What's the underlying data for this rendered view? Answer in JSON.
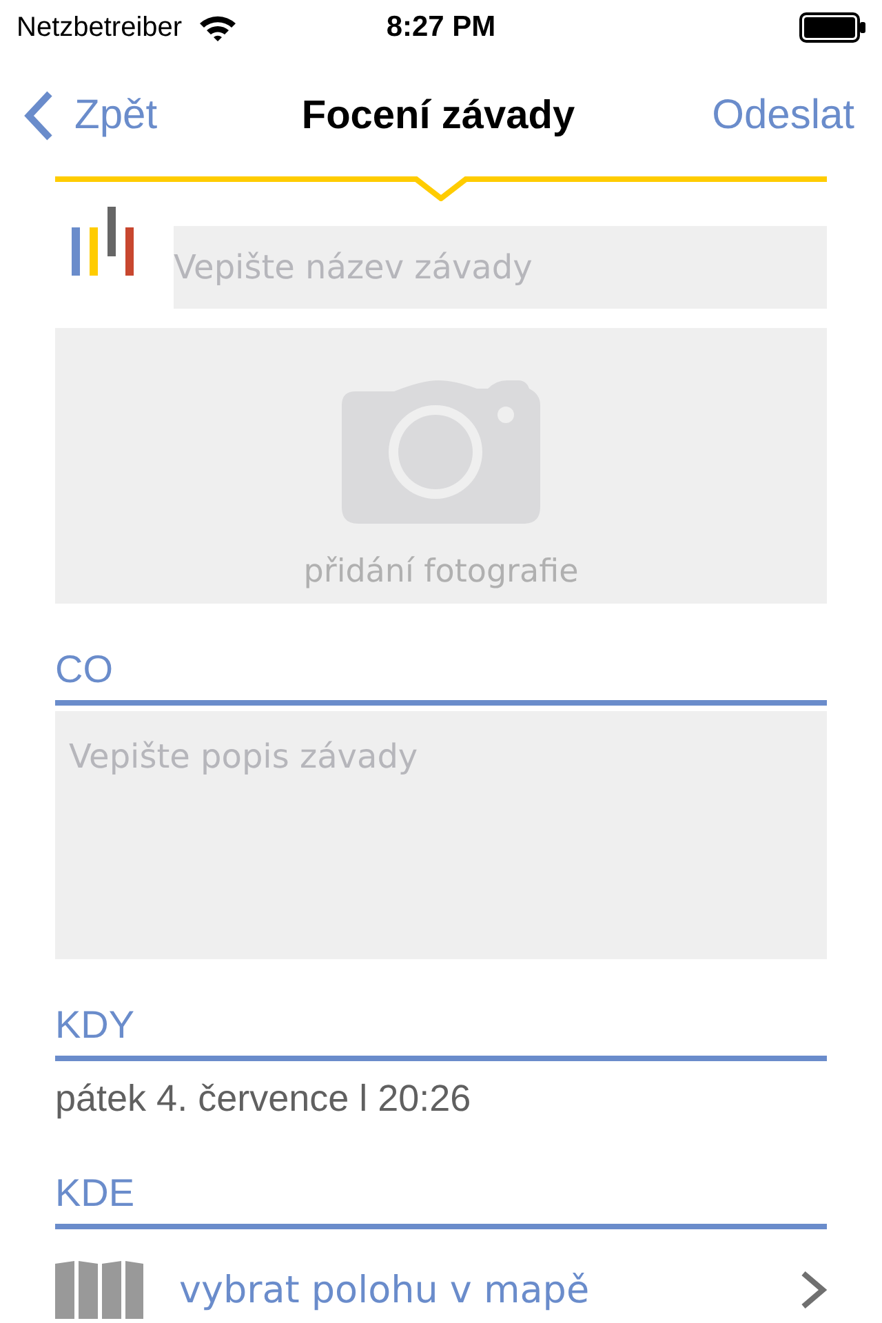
{
  "status_bar": {
    "carrier": "Netzbetreiber",
    "time": "8:27 PM"
  },
  "nav_bar": {
    "back": "Zpět",
    "title": "Focení závady",
    "action": "Odeslat"
  },
  "name_field": {
    "placeholder": "Vepište název závady"
  },
  "photo": {
    "label": "přidání fotografie"
  },
  "sections": [
    {
      "kind": "textarea",
      "heading": "CO",
      "placeholder": "Vepište popis závady"
    },
    {
      "kind": "text",
      "heading": "KDY",
      "value": "pátek 4. července l 20:26"
    },
    {
      "kind": "link",
      "heading": "KDE",
      "label": "vybrat polohu v mapě"
    }
  ]
}
